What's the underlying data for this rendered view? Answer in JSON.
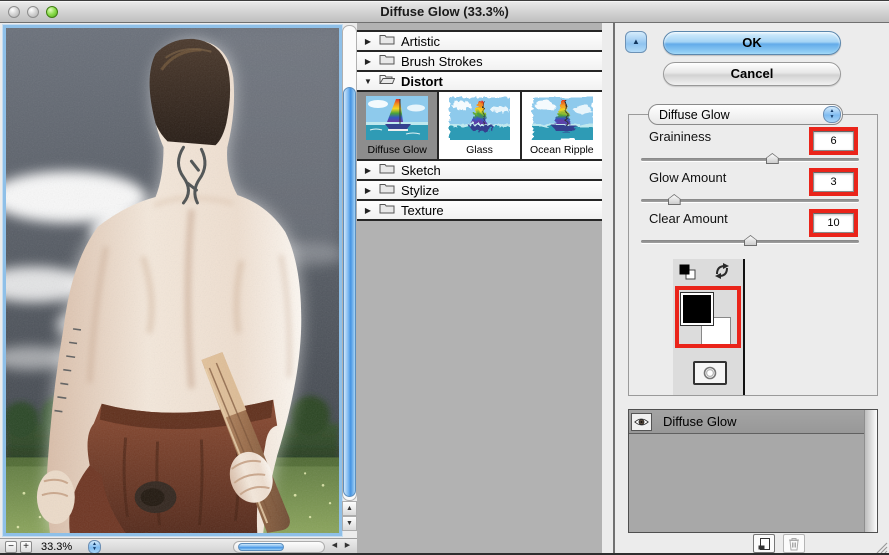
{
  "window": {
    "title": "Diffuse Glow (33.3%)"
  },
  "preview": {
    "zoom_level": "33.3%"
  },
  "glyphs": {
    "minus": "−",
    "plus": "+",
    "up": "▲",
    "down": "▼",
    "left": "◀",
    "right": "▶",
    "collapsed": "▶",
    "expanded": "▼"
  },
  "filter_list": {
    "categories": [
      {
        "label": "Artistic",
        "expanded": false
      },
      {
        "label": "Brush Strokes",
        "expanded": false
      },
      {
        "label": "Distort",
        "expanded": true
      },
      {
        "label": "Sketch",
        "expanded": false
      },
      {
        "label": "Stylize",
        "expanded": false
      },
      {
        "label": "Texture",
        "expanded": false
      }
    ],
    "distort_thumbnails": [
      {
        "label": "Diffuse Glow",
        "selected": true
      },
      {
        "label": "Glass",
        "selected": false
      },
      {
        "label": "Ocean Ripple",
        "selected": false
      }
    ]
  },
  "actions": {
    "ok": "OK",
    "cancel": "Cancel"
  },
  "filter_settings": {
    "selected_filter": "Diffuse Glow",
    "sliders": [
      {
        "label": "Graininess",
        "value": 6,
        "min": 0,
        "max": 10
      },
      {
        "label": "Glow Amount",
        "value": 3,
        "min": 0,
        "max": 20
      },
      {
        "label": "Clear Amount",
        "value": 10,
        "min": 0,
        "max": 20
      }
    ]
  },
  "color_control": {
    "foreground": "#000000",
    "background": "#ffffff"
  },
  "effect_layers": [
    {
      "name": "Diffuse Glow",
      "visible": true
    }
  ],
  "annotations": {
    "highlight_color": "#ea241a"
  }
}
